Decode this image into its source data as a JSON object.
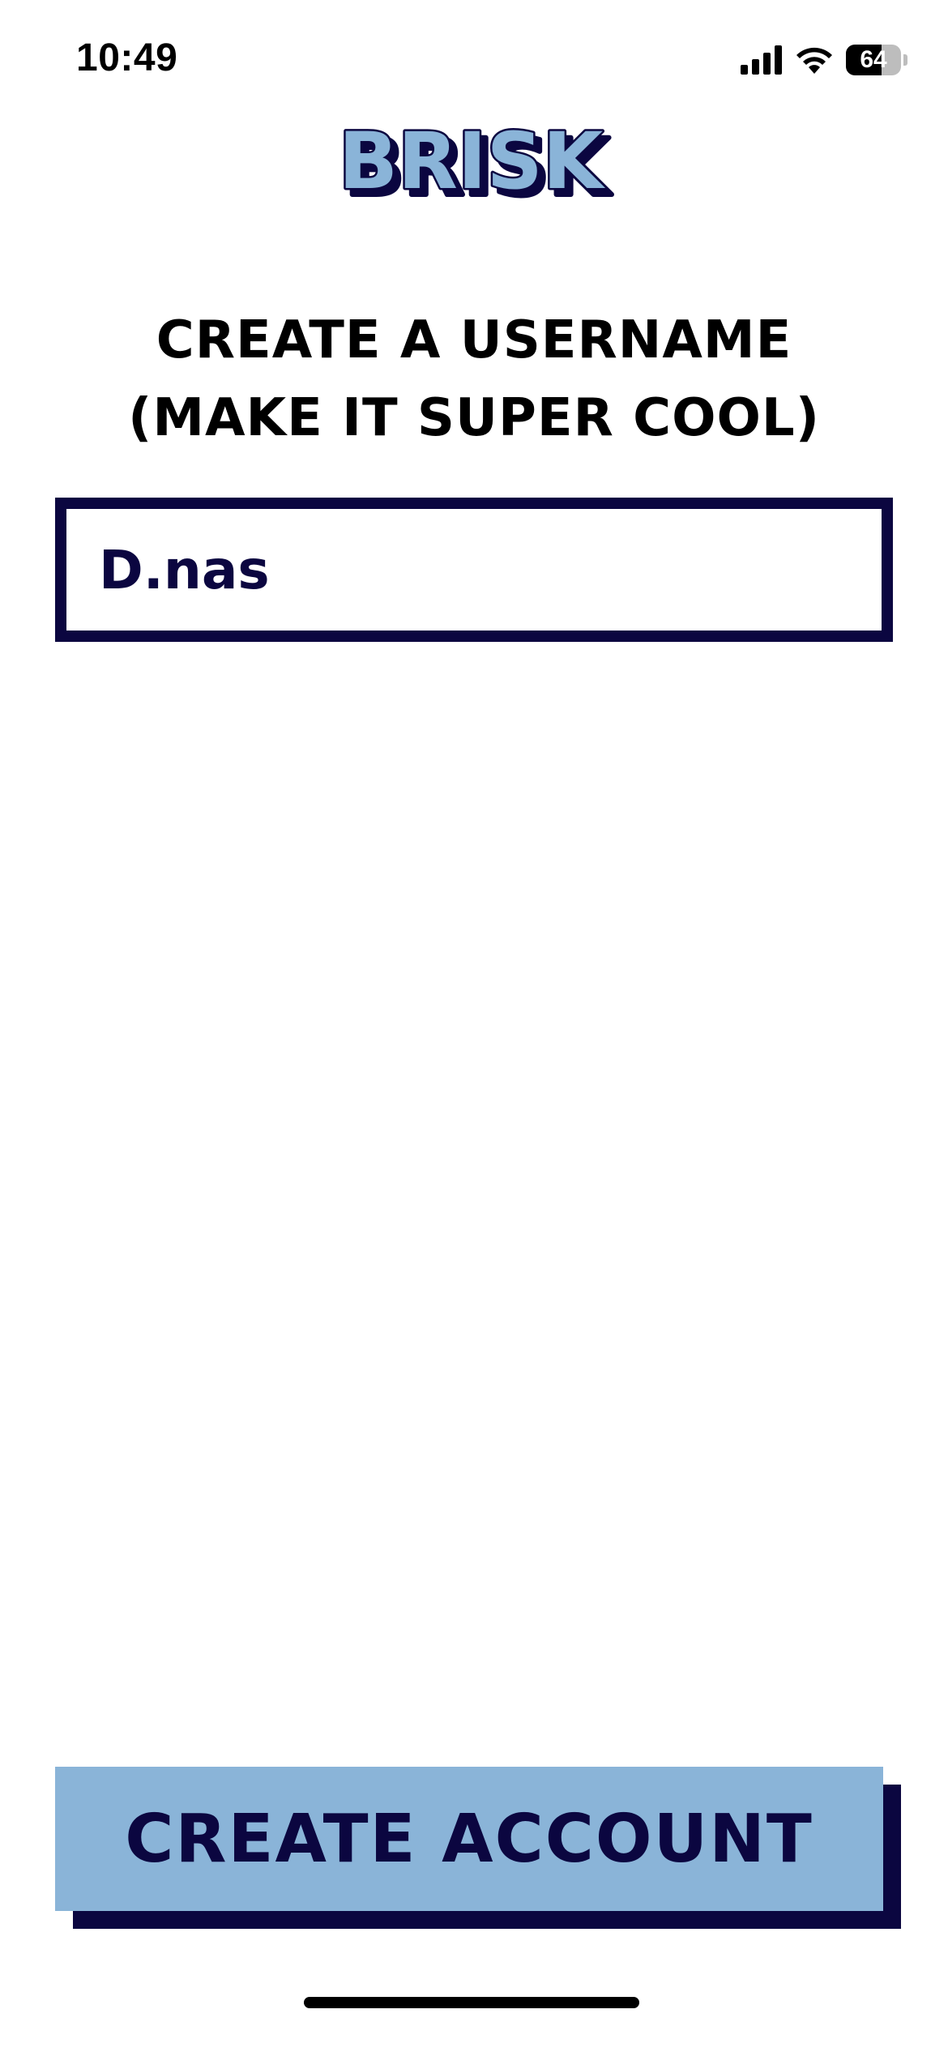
{
  "status_bar": {
    "time": "10:49",
    "battery_level": "64",
    "battery_fraction": 0.64,
    "icons": [
      "cellular-signal-icon",
      "wifi-icon",
      "battery-icon"
    ]
  },
  "logo": {
    "text": "BRISK",
    "fill_color": "#8ab4d8",
    "outline_color": "#0b0640"
  },
  "heading": {
    "line1": "CREATE A USERNAME",
    "line2": "(MAKE IT SUPER COOL)"
  },
  "username_field": {
    "value": "D.nas",
    "placeholder": ""
  },
  "create_account": {
    "label": "CREATE ACCOUNT"
  },
  "colors": {
    "navy": "#0b0640",
    "accent_blue": "#8ab4d8",
    "background": "#ffffff"
  }
}
